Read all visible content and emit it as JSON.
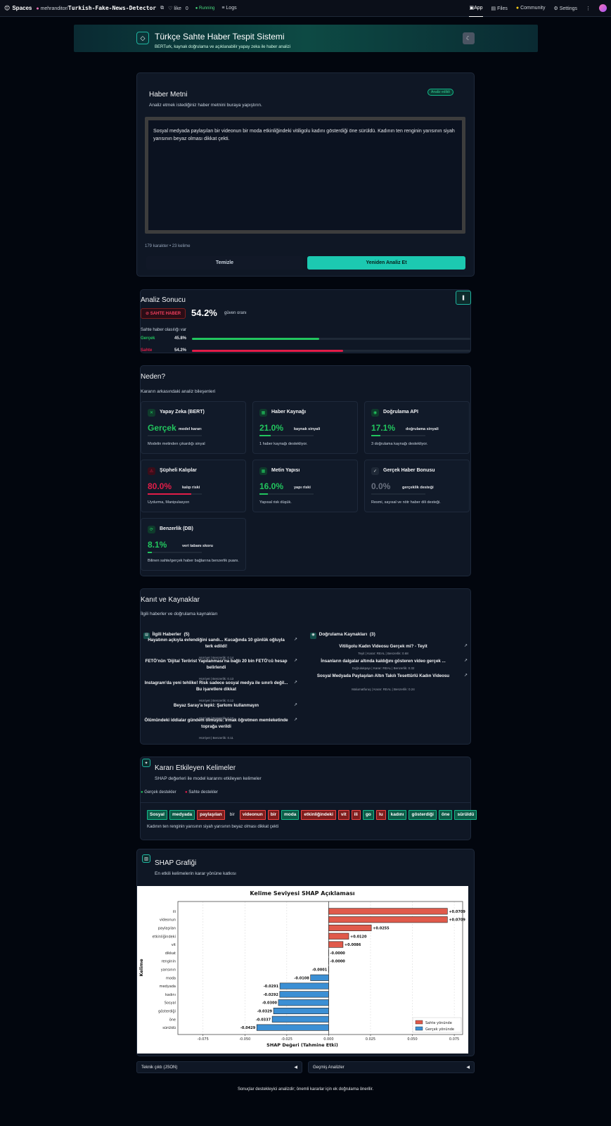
{
  "topbar": {
    "brand": "Spaces",
    "user": "mehranditor",
    "sep": "/",
    "repo": "Turkish-Fake-News-Detector",
    "like": "like",
    "like_count": "0",
    "app_status": "Running",
    "logs": "Logs",
    "tabs": [
      "App",
      "Files",
      "Community",
      "Settings"
    ]
  },
  "header": {
    "title": "Türkçe Sahte Haber Tespit Sistemi",
    "subtitle": "BERTurk, kaynak doğrulama ve açıklanabilir yapay zeka ile haber analizi"
  },
  "input": {
    "title": "Haber Metni",
    "badge": "Analiz edildi",
    "desc": "Analiz etmek istediğiniz haber metnini buraya yapıştırın.",
    "text": "Sosyal medyada paylaşılan bir videonun bir moda etkinliğindeki vitiligolu kadını gösterdiği öne sürüldü. Kadının ten renginin yarısının siyah yarısının beyaz olması dikkat çekti.",
    "stats": "179 karakter • 23 kelime",
    "clear": "Temizle",
    "analyze": "Yeniden Analiz Et"
  },
  "result": {
    "title": "Analiz Sonucu",
    "label": "SAHTE HABER",
    "confidence": "54.2%",
    "confidence_label": "güven oranı",
    "note": "Sahte haber olasılığı var",
    "real_label": "Gerçek",
    "real_value": "45.8%",
    "real_pct": 45.8,
    "fake_label": "Sahte",
    "fake_value": "54.2%",
    "fake_pct": 54.2
  },
  "why": {
    "title": "Neden?",
    "subtitle": "Kararın arkasındaki analiz bileşenleri",
    "cards": [
      {
        "title": "Yapay Zeka (BERT)",
        "value": "Gerçek",
        "label": "model kararı",
        "desc": "Modelin metinden çıkardığı sinyal",
        "pct": 0,
        "color": "#22c55e"
      },
      {
        "title": "Haber Kaynağı",
        "value": "21.0%",
        "label": "kaynak sinyali",
        "desc": "1 haber kaynağı destekliyor.",
        "pct": 21,
        "color": "#22c55e"
      },
      {
        "title": "Doğrulama API",
        "value": "17.1%",
        "label": "doğrulama sinyali",
        "desc": "3 doğrulama kaynağı destekliyor.",
        "pct": 17.1,
        "color": "#22c55e"
      },
      {
        "title": "Şüpheli Kalıplar",
        "value": "80.0%",
        "label": "kalıp riski",
        "desc": "Uydurma, Manipulasyon",
        "pct": 80,
        "color": "#e11d48"
      },
      {
        "title": "Metin Yapısı",
        "value": "16.0%",
        "label": "yapı riski",
        "desc": "Yapısal risk düşük.",
        "pct": 16,
        "color": "#22c55e"
      },
      {
        "title": "Gerçek Haber Bonusu",
        "value": "0.0%",
        "label": "gerçeklik desteği",
        "desc": "Resmi, sayısal ve nötr haber dili desteği.",
        "pct": 0,
        "color": "#6b7280"
      },
      {
        "title": "Benzerlik (DB)",
        "value": "8.1%",
        "label": "veri tabanı skoru",
        "desc": "Bilinen sahte/gerçek haber bağlarına benzerlik puanı.",
        "pct": 8.1,
        "color": "#22c55e"
      }
    ]
  },
  "evidence": {
    "title": "Kanıt ve Kaynaklar",
    "subtitle": "İlgili haberler ve doğrulama kaynakları",
    "news_title": "İlgili Haberler",
    "news_count": "(5)",
    "news": [
      {
        "title": "Hayatının açkıyla evlendiğini sandı... Kucağında 10 günlük oğluyla terk edildi!",
        "meta": "Hürriyet | Benzerlik: 0.14"
      },
      {
        "title": "FETÖ'nün 'Dijital Terörist Yapılanması'na bağlı 20 bin FETÖ'cü hesap belirlendi",
        "meta": "Hürriyet | Benzerlik: 0.13"
      },
      {
        "title": "Instagram'da yeni tehlike! Risk sadece sosyal medya ile sınırlı değil... Bu işaretlere dikkat",
        "meta": "Hürriyet | Benzerlik: 0.12"
      },
      {
        "title": "Beyaz Saray'a tepki: Şarkımı kullanmayın",
        "meta": "Hürriyet | Benzerlik: 0.12"
      },
      {
        "title": "Ölümündeki iddialar gündem olmuştu: Irmak öğretmen memleketinde toprağa verildi",
        "meta": "Hürriyet | Benzerlik: 0.11"
      }
    ],
    "verify_title": "Doğrulama Kaynakları",
    "verify_count": "(3)",
    "verify": [
      {
        "title": "Vitiligolu Kadın Videosu Gerçek mi? - Teyit",
        "meta": "Teyit | Karar: REAL | Benzerlik: 0.68"
      },
      {
        "title": "İnsanların dalgalar altında kaldığını gösteren video gerçek ...",
        "meta": "Doğrulukpayı | Karar: REAL | Benzerlik: 0.32"
      },
      {
        "title": "Sosyal Medyada Paylaşılan Altın Takılı Tesettürlü Kadın Videosu",
        "meta": "Malumatfuruş | Karar: REAL | Benzerlik: 0.24"
      }
    ]
  },
  "words": {
    "title": "Kararı Etkileyen Kelimeler",
    "subtitle": "SHAP değerleri ile model kararını etkileyen kelimeler",
    "legend_real": "Gerçek destekler",
    "legend_fake": "Sahte destekler",
    "tokens": [
      {
        "t": "Sosyal",
        "k": "g"
      },
      {
        "t": "medyada",
        "k": "g"
      },
      {
        "t": "paylaşılan",
        "k": "f"
      },
      {
        "t": "bir",
        "k": "n"
      },
      {
        "t": "videonun",
        "k": "f"
      },
      {
        "t": "bir",
        "k": "f"
      },
      {
        "t": "moda",
        "k": "g"
      },
      {
        "t": "etkinliğindeki",
        "k": "f"
      },
      {
        "t": "vit",
        "k": "f"
      },
      {
        "t": "ili",
        "k": "f"
      },
      {
        "t": "go",
        "k": "g"
      },
      {
        "t": "lu",
        "k": "f"
      },
      {
        "t": "kadını",
        "k": "g"
      },
      {
        "t": "gösterdiği",
        "k": "g"
      },
      {
        "t": "öne",
        "k": "g"
      },
      {
        "t": "sürüldü",
        "k": "g"
      }
    ],
    "rest": "Kadının ten renginin yarısının siyah yarısının beyaz olması dikkat çekti"
  },
  "shap": {
    "title": "SHAP Grafiği",
    "subtitle": "En etkili kelimelerin karar yönüne katkısı"
  },
  "chart_data": {
    "type": "bar",
    "orientation": "horizontal",
    "title": "Kelime Seviyesi SHAP Açıklaması",
    "xlabel": "SHAP Değeri (Tahmine Etki)",
    "ylabel": "Kelime",
    "xlim": [
      -0.09,
      0.08
    ],
    "xticks": [
      "-0.075",
      "-0.050",
      "-0.025",
      "0.000",
      "0.025",
      "0.050",
      "0.075"
    ],
    "xtick_values": [
      -0.075,
      -0.05,
      -0.025,
      0,
      0.025,
      0.05,
      0.075
    ],
    "grid": true,
    "legend_position": "bottom-right",
    "legend": [
      "Sahte yönünde",
      "Gerçek yönünde"
    ],
    "colors": {
      "fake": "#e05a4b",
      "real": "#3b8fd4"
    },
    "categories": [
      "ili",
      "videonun",
      "paylaşılan",
      "etkinliğindeki",
      "vit",
      "dikkat",
      "renginin",
      "yarısının",
      "moda",
      "medyada",
      "kadını",
      "Sosyal",
      "gösterdiği",
      "öne",
      "sürüldü"
    ],
    "values": [
      0.0709,
      0.0709,
      0.0255,
      0.012,
      0.0086,
      -0.0,
      -0.0,
      -0.0001,
      -0.0108,
      -0.0291,
      -0.0292,
      -0.03,
      -0.0329,
      -0.0337,
      -0.0429
    ],
    "labels": [
      "+0.0709",
      "+0.0709",
      "+0.0255",
      "+0.0120",
      "+0.0086",
      "-0.0000",
      "-0.0000",
      "-0.0001",
      "-0.0108",
      "-0.0291",
      "-0.0292",
      "-0.0300",
      "-0.0329",
      "-0.0337",
      "-0.0429"
    ]
  },
  "accordions": {
    "json": "Teknik çıktı (JSON)",
    "history": "Geçmiş Analizler"
  },
  "footer": "Sonuçlar destekleyici analizdir; önemli kararlar için ek doğrulama önerilir."
}
